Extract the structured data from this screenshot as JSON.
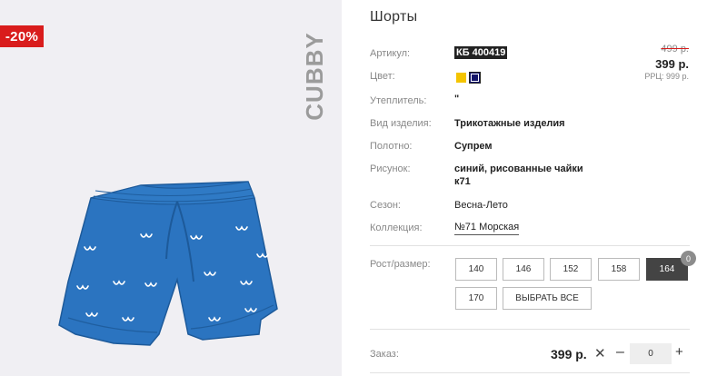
{
  "image": {
    "discount_badge": "-20%",
    "brand_logo": "CUBBY"
  },
  "product": {
    "title": "Шорты",
    "article_label": "Артикул:",
    "article_value": "КБ 400419",
    "color_label": "Цвет:",
    "colors": [
      "#f4c400",
      "#14156a"
    ],
    "insulation_label": "Утеплитель:",
    "insulation_value": "\"",
    "type_label": "Вид изделия:",
    "type_value": "Трикотажные изделия",
    "fabric_label": "Полотно:",
    "fabric_value": "Супрем",
    "pattern_label": "Рисунок:",
    "pattern_value_line1": "синий, рисованные чайки",
    "pattern_value_line2": "к71",
    "season_label": "Сезон:",
    "season_value": "Весна-Лето",
    "collection_label": "Коллекция:",
    "collection_value": "№71 Морская"
  },
  "price": {
    "old": "499 р.",
    "new": "399 р.",
    "rrp": "РРЦ: 999 р."
  },
  "sizes": {
    "label": "Рост/размер:",
    "options": [
      "140",
      "146",
      "152",
      "158",
      "164",
      "170"
    ],
    "selected": "164",
    "select_all": "ВЫБРАТЬ ВСЕ",
    "count_badge": "0"
  },
  "order": {
    "label": "Заказ:",
    "price": "399 р.",
    "remove_icon": "close-icon",
    "minus": "–",
    "quantity": "0",
    "plus": "+"
  },
  "colors": {
    "accent_red": "#d91c1c",
    "shorts_blue": "#2b74c0",
    "selected_size_bg": "#444444"
  }
}
